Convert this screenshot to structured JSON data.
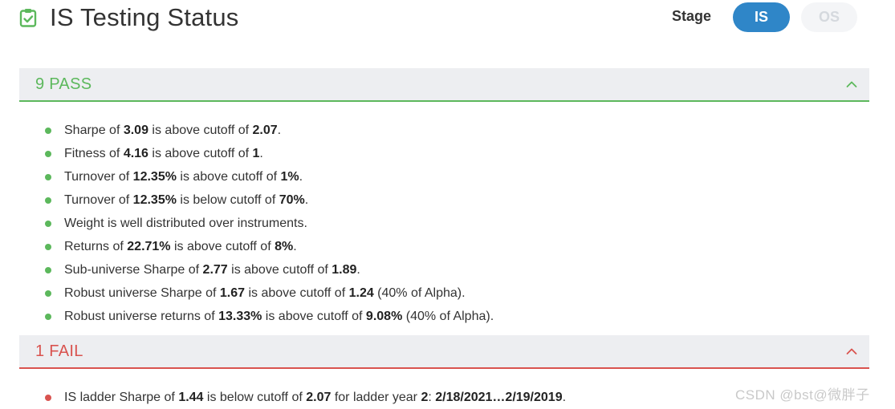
{
  "header": {
    "title": "IS Testing Status",
    "icon": "clipboard-check-icon",
    "stage_label": "Stage",
    "stage_options": [
      "IS",
      "OS"
    ],
    "stage_selected": "IS"
  },
  "pass_section": {
    "heading": "9 PASS",
    "color": "#5cb85c",
    "items": [
      [
        "Sharpe of ",
        "3.09",
        " is above cutoff of ",
        "2.07",
        "."
      ],
      [
        "Fitness of ",
        "4.16",
        " is above cutoff of ",
        "1",
        "."
      ],
      [
        "Turnover of ",
        "12.35%",
        " is above cutoff of ",
        "1%",
        "."
      ],
      [
        "Turnover of ",
        "12.35%",
        " is below cutoff of ",
        "70%",
        "."
      ],
      [
        "Weight is well distributed over instruments."
      ],
      [
        "Returns of ",
        "22.71%",
        " is above cutoff of ",
        "8%",
        "."
      ],
      [
        "Sub-universe Sharpe of ",
        "2.77",
        " is above cutoff of ",
        "1.89",
        "."
      ],
      [
        "Robust universe Sharpe of ",
        "1.67",
        " is above cutoff of ",
        "1.24",
        " (40% of Alpha)."
      ],
      [
        "Robust universe returns of ",
        "13.33%",
        " is above cutoff of ",
        "9.08%",
        " (40% of Alpha)."
      ]
    ]
  },
  "fail_section": {
    "heading": "1 FAIL",
    "color": "#d9534f",
    "items": [
      [
        "IS ladder Sharpe of ",
        "1.44",
        " is below cutoff of ",
        "2.07",
        " for ladder year ",
        "2",
        ": ",
        "2/18/2021…2/19/2019",
        "."
      ]
    ]
  },
  "watermark": "CSDN @bst@微胖子",
  "colors": {
    "accent": "#2f86c8",
    "pass": "#5cb85c",
    "fail": "#d9534f"
  }
}
